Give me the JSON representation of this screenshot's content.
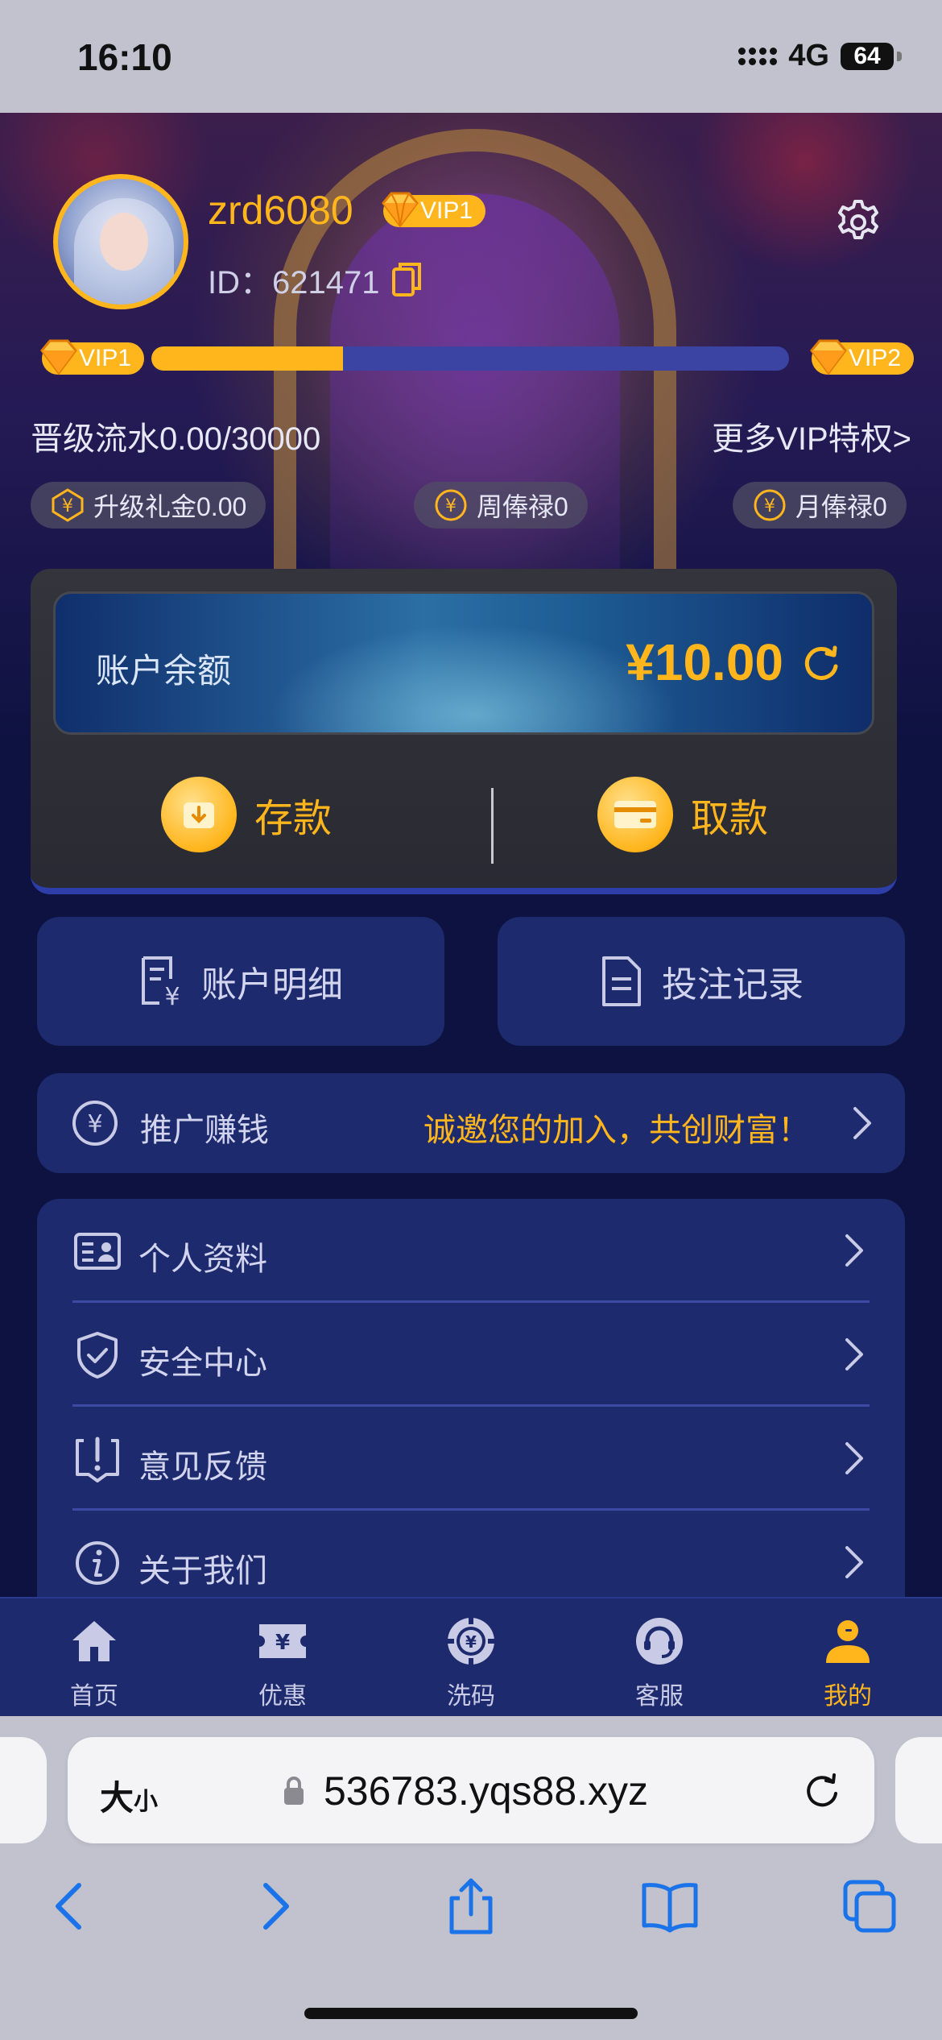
{
  "status_bar": {
    "time": "16:10",
    "network": "4G",
    "battery": "64"
  },
  "profile": {
    "username": "zrd6080",
    "vip_level": "VIP1",
    "id_label": "ID：",
    "id_value": "621471"
  },
  "vip_progress": {
    "current_level": "VIP1",
    "next_level": "VIP2",
    "progress_fraction": 0.3,
    "upgrade_text": "晋级流水0.00/30000",
    "more_link": "更多VIP特权>"
  },
  "rewards": [
    {
      "icon": "yen-coin-icon",
      "label": "升级礼金0.00"
    },
    {
      "icon": "yen-coin-icon",
      "label": "周俸禄0"
    },
    {
      "icon": "yen-coin-icon",
      "label": "月俸禄0"
    }
  ],
  "balance": {
    "label": "账户余额",
    "amount": "¥10.00",
    "deposit_label": "存款",
    "withdraw_label": "取款"
  },
  "quick_nav": {
    "account_details": "账户明细",
    "bet_records": "投注记录"
  },
  "promo": {
    "label": "推广赚钱",
    "tagline": "诚邀您的加入，共创财富！"
  },
  "menu": [
    {
      "icon": "id-card-icon",
      "label": "个人资料"
    },
    {
      "icon": "shield-check-icon",
      "label": "安全中心"
    },
    {
      "icon": "feedback-icon",
      "label": "意见反馈"
    },
    {
      "icon": "info-icon",
      "label": "关于我们"
    }
  ],
  "tabbar": [
    {
      "icon": "home-icon",
      "label": "首页",
      "active": false
    },
    {
      "icon": "ticket-icon",
      "label": "优惠",
      "active": false
    },
    {
      "icon": "chip-icon",
      "label": "洗码",
      "active": false
    },
    {
      "icon": "headset-icon",
      "label": "客服",
      "active": false
    },
    {
      "icon": "user-icon",
      "label": "我的",
      "active": true
    }
  ],
  "browser": {
    "text_size_label_big": "大",
    "text_size_label_small": "小",
    "url": "536783.yqs88.xyz"
  },
  "colors": {
    "accent": "#ffb51c",
    "card": "#1d2a6e",
    "background": "#0d1240"
  }
}
